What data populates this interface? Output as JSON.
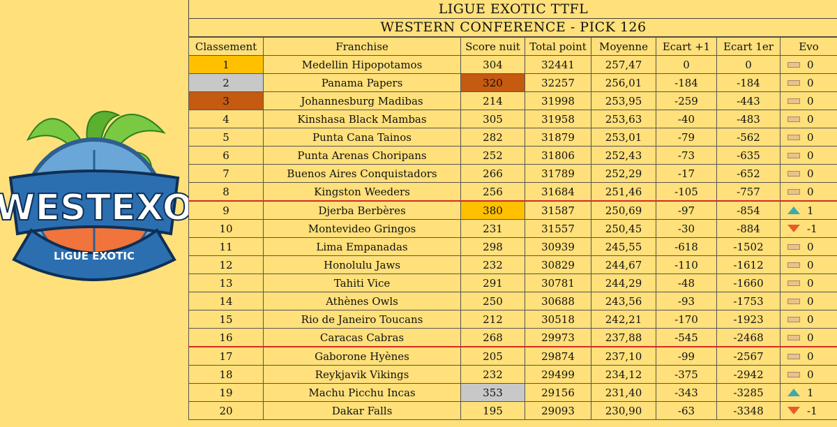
{
  "title": "LIGUE EXOTIC TTFL",
  "subtitle": "WESTERN CONFERENCE - PICK 126",
  "logo": {
    "name": "WESTEXO",
    "tagline": "LIGUE EXOTIC"
  },
  "columns": [
    "Classement",
    "Franchise",
    "Score nuit",
    "Total point",
    "Moyenne",
    "Ecart +1",
    "Ecart 1er",
    "Evo"
  ],
  "rows": [
    {
      "rank": "1",
      "team": "Medellin Hipopotamos",
      "score": "304",
      "total": "32441",
      "avg": "257,47",
      "e1": "0",
      "e1er": "0",
      "evo": "0",
      "dir": "flat",
      "rank_color": "gold"
    },
    {
      "rank": "2",
      "team": "Panama Papers",
      "score": "320",
      "total": "32257",
      "avg": "256,01",
      "e1": "-184",
      "e1er": "-184",
      "evo": "0",
      "dir": "flat",
      "rank_color": "silver",
      "score_color": "bronze"
    },
    {
      "rank": "3",
      "team": "Johannesburg Madibas",
      "score": "214",
      "total": "31998",
      "avg": "253,95",
      "e1": "-259",
      "e1er": "-443",
      "evo": "0",
      "dir": "flat",
      "rank_color": "bronze"
    },
    {
      "rank": "4",
      "team": "Kinshasa Black Mambas",
      "score": "305",
      "total": "31958",
      "avg": "253,63",
      "e1": "-40",
      "e1er": "-483",
      "evo": "0",
      "dir": "flat"
    },
    {
      "rank": "5",
      "team": "Punta Cana Tainos",
      "score": "282",
      "total": "31879",
      "avg": "253,01",
      "e1": "-79",
      "e1er": "-562",
      "evo": "0",
      "dir": "flat"
    },
    {
      "rank": "6",
      "team": "Punta Arenas Choripans",
      "score": "252",
      "total": "31806",
      "avg": "252,43",
      "e1": "-73",
      "e1er": "-635",
      "evo": "0",
      "dir": "flat"
    },
    {
      "rank": "7",
      "team": "Buenos Aires Conquistadors",
      "score": "266",
      "total": "31789",
      "avg": "252,29",
      "e1": "-17",
      "e1er": "-652",
      "evo": "0",
      "dir": "flat"
    },
    {
      "rank": "8",
      "team": "Kingston Weeders",
      "score": "256",
      "total": "31684",
      "avg": "251,46",
      "e1": "-105",
      "e1er": "-757",
      "evo": "0",
      "dir": "flat",
      "sep": true
    },
    {
      "rank": "9",
      "team": "Djerba Berbères",
      "score": "380",
      "total": "31587",
      "avg": "250,69",
      "e1": "-97",
      "e1er": "-854",
      "evo": "1",
      "dir": "up",
      "score_color": "gold"
    },
    {
      "rank": "10",
      "team": "Montevideo Gringos",
      "score": "231",
      "total": "31557",
      "avg": "250,45",
      "e1": "-30",
      "e1er": "-884",
      "evo": "-1",
      "dir": "down"
    },
    {
      "rank": "11",
      "team": "Lima Empanadas",
      "score": "298",
      "total": "30939",
      "avg": "245,55",
      "e1": "-618",
      "e1er": "-1502",
      "evo": "0",
      "dir": "flat"
    },
    {
      "rank": "12",
      "team": "Honolulu Jaws",
      "score": "232",
      "total": "30829",
      "avg": "244,67",
      "e1": "-110",
      "e1er": "-1612",
      "evo": "0",
      "dir": "flat"
    },
    {
      "rank": "13",
      "team": "Tahiti Vice",
      "score": "291",
      "total": "30781",
      "avg": "244,29",
      "e1": "-48",
      "e1er": "-1660",
      "evo": "0",
      "dir": "flat"
    },
    {
      "rank": "14",
      "team": "Athènes Owls",
      "score": "250",
      "total": "30688",
      "avg": "243,56",
      "e1": "-93",
      "e1er": "-1753",
      "evo": "0",
      "dir": "flat"
    },
    {
      "rank": "15",
      "team": "Rio de Janeiro Toucans",
      "score": "212",
      "total": "30518",
      "avg": "242,21",
      "e1": "-170",
      "e1er": "-1923",
      "evo": "0",
      "dir": "flat"
    },
    {
      "rank": "16",
      "team": "Caracas Cabras",
      "score": "268",
      "total": "29973",
      "avg": "237,88",
      "e1": "-545",
      "e1er": "-2468",
      "evo": "0",
      "dir": "flat",
      "sep": true
    },
    {
      "rank": "17",
      "team": "Gaborone Hyènes",
      "score": "205",
      "total": "29874",
      "avg": "237,10",
      "e1": "-99",
      "e1er": "-2567",
      "evo": "0",
      "dir": "flat"
    },
    {
      "rank": "18",
      "team": "Reykjavik Vikings",
      "score": "232",
      "total": "29499",
      "avg": "234,12",
      "e1": "-375",
      "e1er": "-2942",
      "evo": "0",
      "dir": "flat"
    },
    {
      "rank": "19",
      "team": "Machu Picchu Incas",
      "score": "353",
      "total": "29156",
      "avg": "231,40",
      "e1": "-343",
      "e1er": "-3285",
      "evo": "1",
      "dir": "up",
      "score_color": "silver"
    },
    {
      "rank": "20",
      "team": "Dakar Falls",
      "score": "195",
      "total": "29093",
      "avg": "230,90",
      "e1": "-63",
      "e1er": "-3348",
      "evo": "-1",
      "dir": "down"
    }
  ],
  "colors": {
    "background": "#ffe07a",
    "gold": "#ffc000",
    "silver": "#c8c8c8",
    "bronze": "#c55a11",
    "separator": "#d42a1f",
    "up": "#3fa8a8",
    "down": "#e85a2a"
  }
}
